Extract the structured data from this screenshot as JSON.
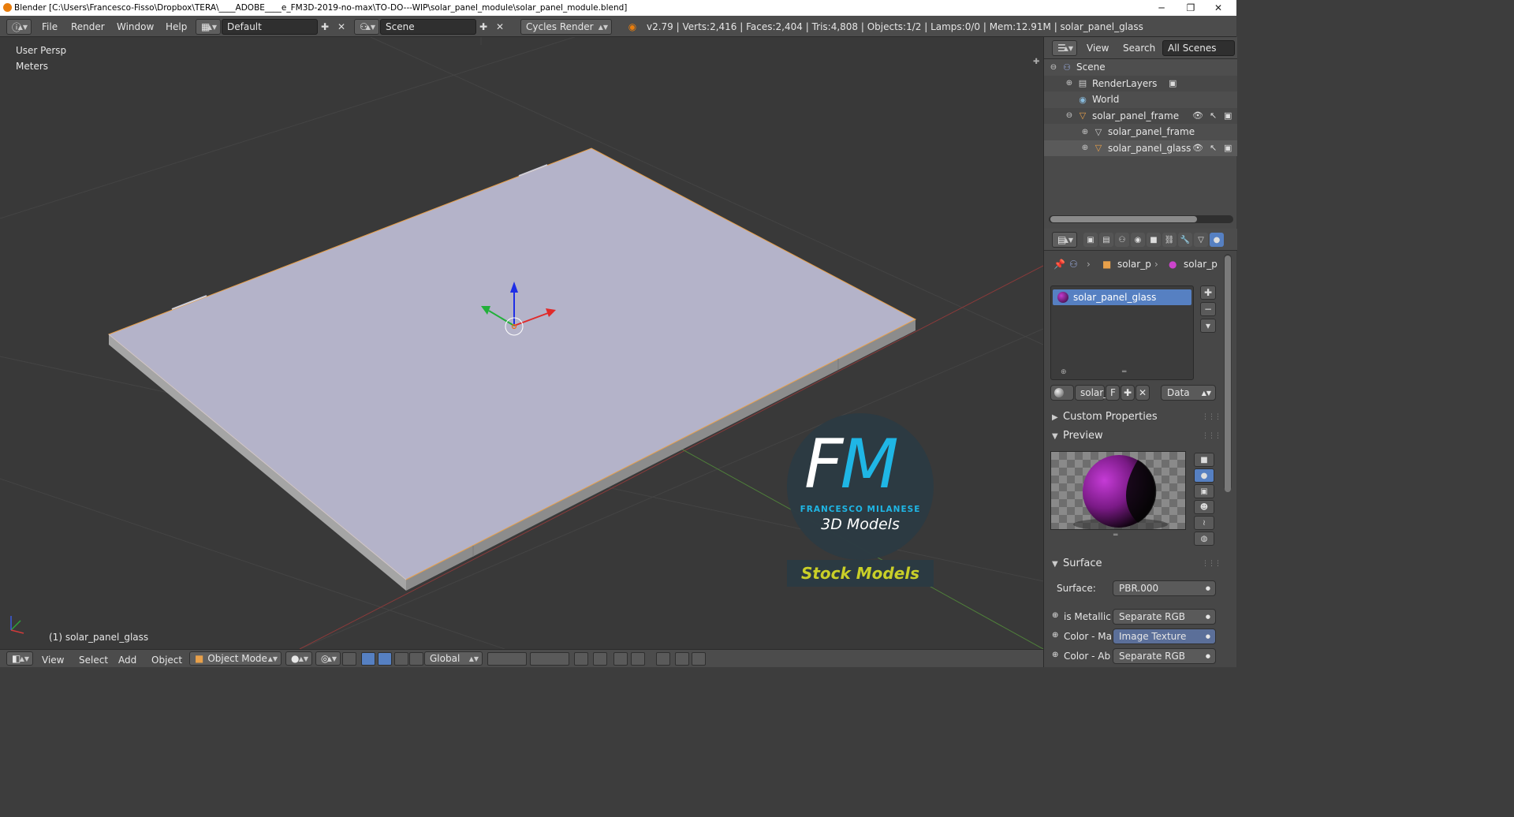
{
  "window": {
    "title": "Blender [C:\\Users\\Francesco-Fisso\\Dropbox\\TERA\\____ADOBE____e_FM3D-2019-no-max\\TO-DO---WIP\\solar_panel_module\\solar_panel_module.blend]",
    "minimize": "─",
    "restore": "❐",
    "close": "✕"
  },
  "header": {
    "menus": [
      "File",
      "Render",
      "Window",
      "Help"
    ],
    "layout": "Default",
    "scene": "Scene",
    "engine": "Cycles Render",
    "stats": "v2.79 | Verts:2,416 | Faces:2,404 | Tris:4,808 | Objects:1/2 | Lamps:0/0 | Mem:12.91M | solar_panel_glass"
  },
  "viewport": {
    "view_name": "User Persp",
    "units": "Meters",
    "active_object": "(1) solar_panel_glass",
    "colors": {
      "background": "#393939",
      "panel_top": "#b4b3c9",
      "panel_side": "#8f8f8f",
      "selection": "#e8a04a"
    }
  },
  "watermark": {
    "letter_f": "F",
    "letter_m": "M",
    "brand": "FRANCESCO MILANESE",
    "tagline": "3D Models",
    "banner": "Stock Models"
  },
  "footer": {
    "menus": [
      "View",
      "Select",
      "Add",
      "Object"
    ],
    "mode": "Object Mode",
    "orientation": "Global"
  },
  "outliner": {
    "tabs": [
      "View",
      "Search",
      "All Scenes"
    ],
    "rows": [
      {
        "label": "Scene",
        "icon": "scene-icon"
      },
      {
        "label": "RenderLayers",
        "icon": "renderlayers-icon"
      },
      {
        "label": "World",
        "icon": "world-icon"
      },
      {
        "label": "solar_panel_frame",
        "icon": "mesh-object-icon"
      },
      {
        "label": "solar_panel_frame",
        "icon": "mesh-data-icon"
      },
      {
        "label": "solar_panel_glass",
        "icon": "mesh-object-icon"
      }
    ]
  },
  "properties": {
    "breadcrumb": [
      "solar_p",
      "solar_p"
    ],
    "material_slot": "solar_panel_glass",
    "material_name": "solar_",
    "fake_user": "F",
    "link": "Data",
    "panels": {
      "custom_properties": "Custom Properties",
      "preview": "Preview",
      "surface": "Surface"
    },
    "surface": {
      "label": "Surface:",
      "value": "PBR.000"
    },
    "inputs": [
      {
        "label": "is Metallic",
        "value": "Separate RGB"
      },
      {
        "label": "Color - Ma",
        "value": "Image Texture"
      },
      {
        "label": "Color - Ab",
        "value": "Separate RGB"
      }
    ]
  }
}
